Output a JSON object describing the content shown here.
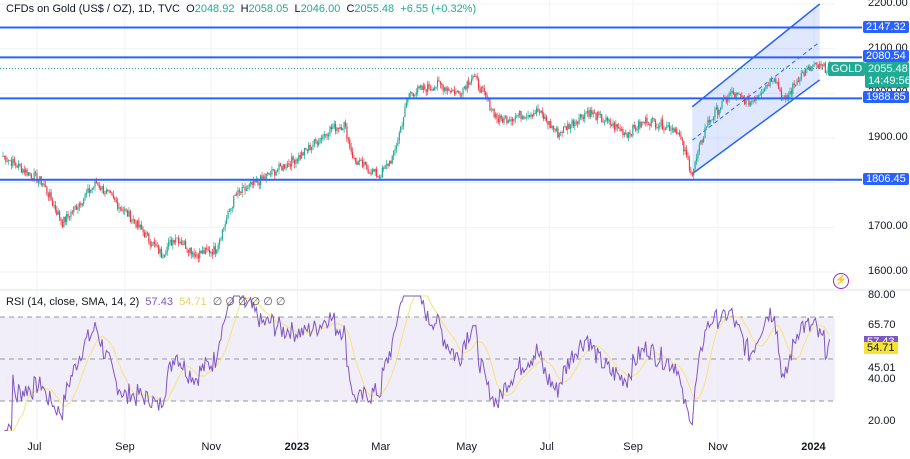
{
  "header": {
    "symbol": "CFDs on Gold (US$ / OZ), 1D, TVC",
    "o_label": "O",
    "o": "2048.92",
    "h_label": "H",
    "h": "2058.05",
    "l_label": "L",
    "l": "2046.00",
    "c_label": "C",
    "c": "2055.48",
    "change": "+6.55 (+0.32%)"
  },
  "rsi_header": {
    "title": "RSI (14, close, SMA, 14, 2)",
    "rsi": "57.43",
    "sma": "54.71",
    "empty_icons": "∅ ∅ ∅ ∅ ∅ ∅"
  },
  "price_tag": {
    "symbol": "GOLD",
    "price": "2055.48",
    "countdown": "14:49:56"
  },
  "colors": {
    "up": "#22ab94",
    "down": "#f23645",
    "line": "#2962ff",
    "rsi": "#7e57c2",
    "rsi_sma": "#f5e37d"
  },
  "chart_data": [
    {
      "type": "candlestick",
      "title": "CFDs on Gold (US$ / OZ), 1D, TVC",
      "ylim": [
        1580,
        2210
      ],
      "yticks": [
        "2200.00",
        "2100.00",
        "2000.00",
        "1900.00",
        "1800.00",
        "1700.00",
        "1600.00"
      ],
      "xticks": [
        {
          "label": "Jul",
          "day": 24
        },
        {
          "label": "Sep",
          "day": 86
        },
        {
          "label": "Nov",
          "day": 147
        },
        {
          "label": "2023",
          "day": 208
        },
        {
          "label": "Mar",
          "day": 267
        },
        {
          "label": "May",
          "day": 327
        },
        {
          "label": "Jul",
          "day": 386
        },
        {
          "label": "Sep",
          "day": 445
        },
        {
          "label": "Nov",
          "day": 505
        },
        {
          "label": "2024",
          "day": 573
        }
      ],
      "days": 585,
      "anchors": [
        [
          0,
          1860
        ],
        [
          28,
          1800
        ],
        [
          42,
          1710
        ],
        [
          66,
          1800
        ],
        [
          91,
          1720
        ],
        [
          112,
          1640
        ],
        [
          122,
          1680
        ],
        [
          136,
          1640
        ],
        [
          150,
          1650
        ],
        [
          164,
          1770
        ],
        [
          189,
          1820
        ],
        [
          210,
          1860
        ],
        [
          231,
          1920
        ],
        [
          241,
          1930
        ],
        [
          248,
          1850
        ],
        [
          266,
          1815
        ],
        [
          276,
          1860
        ],
        [
          287,
          2000
        ],
        [
          308,
          2020
        ],
        [
          322,
          2000
        ],
        [
          332,
          2040
        ],
        [
          350,
          1940
        ],
        [
          378,
          1960
        ],
        [
          392,
          1910
        ],
        [
          413,
          1960
        ],
        [
          441,
          1910
        ],
        [
          455,
          1940
        ],
        [
          476,
          1920
        ],
        [
          487,
          1820
        ],
        [
          497,
          1930
        ],
        [
          514,
          2000
        ],
        [
          528,
          1980
        ],
        [
          545,
          2040
        ],
        [
          552,
          1980
        ],
        [
          563,
          2040
        ],
        [
          573,
          2060
        ],
        [
          584,
          2055
        ]
      ],
      "horizontal_levels": [
        "2147.32",
        "2080.54",
        "1988.85",
        "1806.45"
      ],
      "channel": {
        "start_day": 487,
        "end_day": 577,
        "lower": [
          1820,
          2030
        ],
        "upper": [
          1970,
          2200
        ]
      }
    },
    {
      "type": "line",
      "title": "RSI (14, close, SMA, 14, 2)",
      "ylim": [
        15,
        82
      ],
      "yticks": [
        "80.00",
        "65.70",
        "45.01",
        "40.00",
        "20.00"
      ],
      "bands": [
        30,
        50,
        70
      ],
      "last": {
        "rsi": "57.43",
        "sma": "54.71"
      }
    }
  ]
}
